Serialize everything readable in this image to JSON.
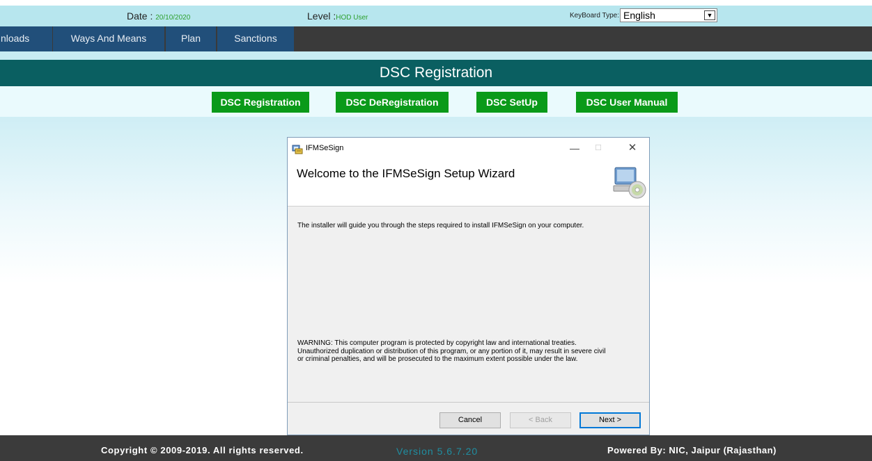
{
  "header": {
    "date_label": "Date : ",
    "date_value": "20/10/2020",
    "level_label": "Level :",
    "level_value": "HOD User",
    "keyboard_label": "KeyBoard Type:",
    "keyboard_value": "English"
  },
  "nav": {
    "tabs": [
      "nloads",
      "Ways And Means",
      "Plan",
      "Sanctions"
    ]
  },
  "page": {
    "title": "DSC Registration",
    "buttons": [
      "DSC Registration",
      "DSC DeRegistration",
      "DSC SetUp",
      "DSC User Manual"
    ]
  },
  "dialog": {
    "window_title": "IFMSeSign",
    "heading": "Welcome to the IFMSeSign Setup Wizard",
    "intro": "The installer will guide you through the steps required to install IFMSeSign on your computer.",
    "warning_lines": [
      "WARNING: This computer program is protected by copyright law and international treaties.",
      "Unauthorized duplication or distribution of this program, or any portion of it, may result in severe civil",
      "or criminal penalties, and will be prosecuted to the maximum extent possible under the law."
    ],
    "cancel_label": "Cancel",
    "back_label": "< Back",
    "next_label": "Next >",
    "minimize_glyph": "—",
    "maximize_glyph": "☐",
    "close_glyph": "✕",
    "icons": [
      "setup-app-icon",
      "computer-cd-icon"
    ]
  },
  "footer": {
    "copyright": "Copyright © 2009-2019. All rights reserved.",
    "version": "Version 5.6.7.20",
    "powered_by": "Powered By: NIC, Jaipur (Rajasthan)"
  },
  "colors": {
    "topbar": "#b7e6ee",
    "nav_tab": "#214f7a",
    "title_band": "#0a5f61",
    "dsc_button": "#0a9a19",
    "footer": "#3b3b3b",
    "version_text": "#1f8ea1"
  }
}
